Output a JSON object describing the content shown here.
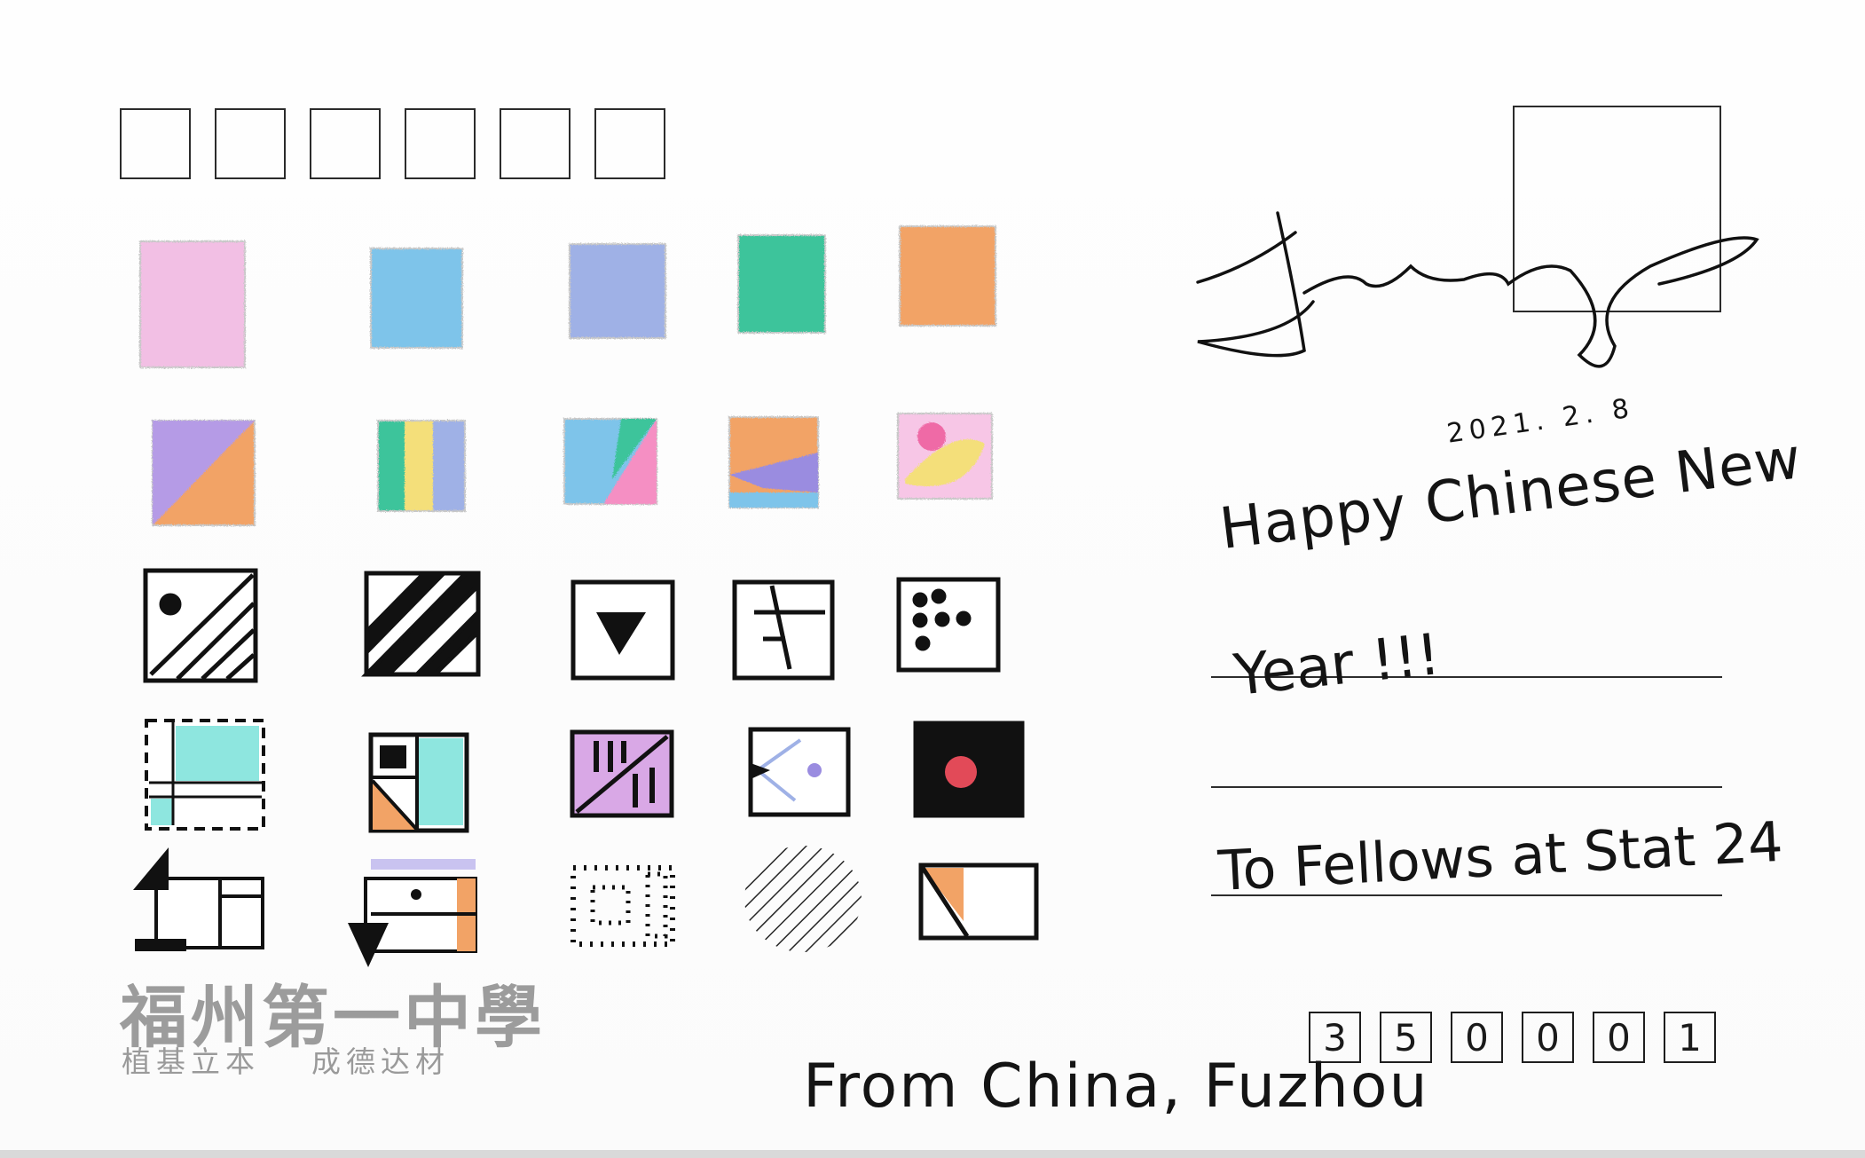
{
  "greeting": {
    "line1": "Happy Chinese New",
    "line2": "Year !!!",
    "line3": "To Fellows at Stat 24"
  },
  "date": "2021. 2. 8",
  "from": "From China, Fuzhou",
  "postal_code_digits": [
    "3",
    "5",
    "0",
    "0",
    "0",
    "1"
  ],
  "school": {
    "name": "福州第一中學",
    "motto_left": "植基立本",
    "motto_right": "成德达材"
  },
  "colors": {
    "ink": "#141414",
    "pink": "#f2bfe4",
    "blue": "#7ec4ea",
    "periwinkle": "#9fb1e6",
    "green": "#3ec49b",
    "orange": "#f2a366",
    "purple": "#b59be6",
    "yellow": "#f4df7a",
    "cyan": "#8ee6df",
    "red": "#e24a58",
    "lilac": "#d9a8e6",
    "watermark": "#9c9c9c"
  }
}
